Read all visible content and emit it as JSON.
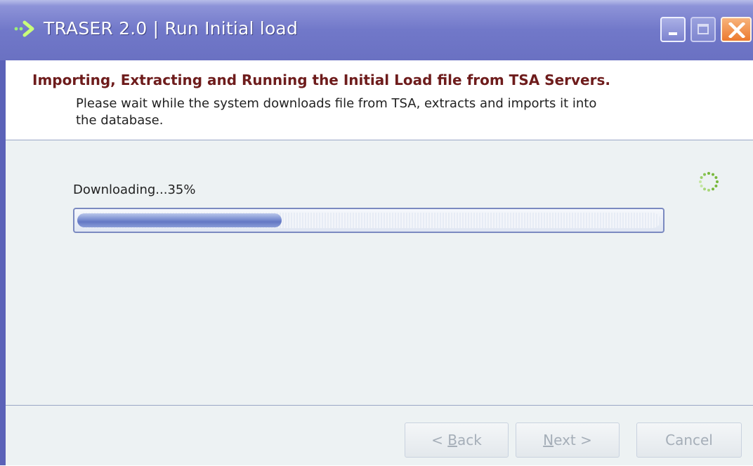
{
  "window": {
    "title": "TRASER 2.0 | Run Initial load",
    "controls": [
      "minimize-icon",
      "maximize-icon",
      "close-icon"
    ]
  },
  "header": {
    "heading": "Importing, Extracting and Running the Initial Load file from TSA Servers.",
    "description": "Please wait while the system downloads file from TSA, extracts and imports it into the database."
  },
  "progress": {
    "status_text": "Downloading...35%",
    "value": 0.35,
    "indicator_icon": "spinner-icon"
  },
  "footer": {
    "back": {
      "before": "< ",
      "mnemonic": "B",
      "after": "ack"
    },
    "next": {
      "mnemonic": "N",
      "after": "ext >"
    },
    "cancel": "Cancel"
  },
  "colors": {
    "titlebar": "#6a71c2",
    "heading": "#6e1c1c",
    "close_button": "#ec7a2f",
    "progress_fill": "#6377c4"
  }
}
